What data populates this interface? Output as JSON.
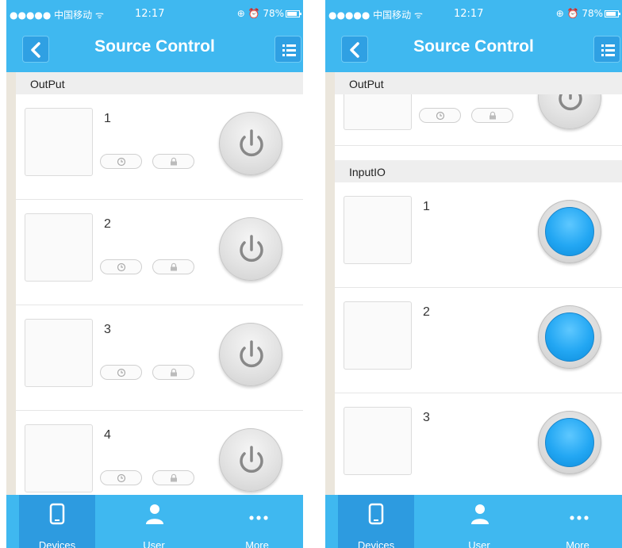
{
  "status_bar": {
    "carrier": "●●●●● 中国移动 ᯤ",
    "time": "12:17",
    "right": "⊕ ⏰ 78%"
  },
  "nav": {
    "title": "Source Control",
    "back_icon": "chevron-left-icon",
    "menu_icon": "list-icon"
  },
  "left_screen": {
    "section": "OutPut",
    "rows": [
      {
        "num": "1"
      },
      {
        "num": "2"
      },
      {
        "num": "3"
      },
      {
        "num": "4"
      }
    ]
  },
  "right_screen": {
    "output_section": "OutPut",
    "input_section": "InputIO",
    "input_rows": [
      {
        "num": "1"
      },
      {
        "num": "2"
      },
      {
        "num": "3"
      }
    ]
  },
  "tabs": [
    {
      "label": "Devices",
      "icon": "phone-icon",
      "active": true
    },
    {
      "label": "User",
      "icon": "user-icon",
      "active": false
    },
    {
      "label": "More",
      "icon": "more-icon",
      "active": false
    }
  ],
  "colors": {
    "accent": "#3fb8f0",
    "accent_dark": "#2d9be0",
    "led": "#23a7f3"
  }
}
